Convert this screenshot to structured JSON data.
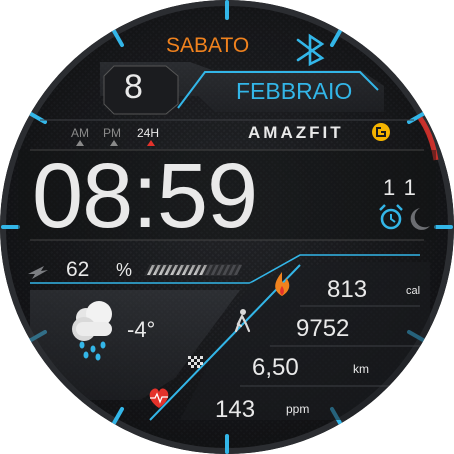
{
  "date": {
    "weekday": "SABATO",
    "day": "8",
    "month": "FEBBRAIO"
  },
  "format": {
    "am": "AM",
    "pm": "PM",
    "h24": "24H",
    "active": "24H"
  },
  "brand": {
    "name": "AMAZFIT"
  },
  "time": {
    "display": "08:59",
    "seconds": "11"
  },
  "battery": {
    "percent": "62",
    "unit": "%",
    "level": 0.62
  },
  "weather": {
    "temperature": "-4°",
    "icon": "rain-cloud-icon"
  },
  "stats": {
    "calories_value": "813",
    "calories_unit": "cal",
    "steps_value": "9752",
    "distance_value": "6,50",
    "distance_unit": "km",
    "heart_value": "143",
    "heart_unit": "ppm"
  },
  "colors": {
    "accent_blue": "#33b6e8",
    "accent_orange": "#f0821e",
    "heart_red": "#e4322b",
    "text_light": "#e9e9e9"
  }
}
